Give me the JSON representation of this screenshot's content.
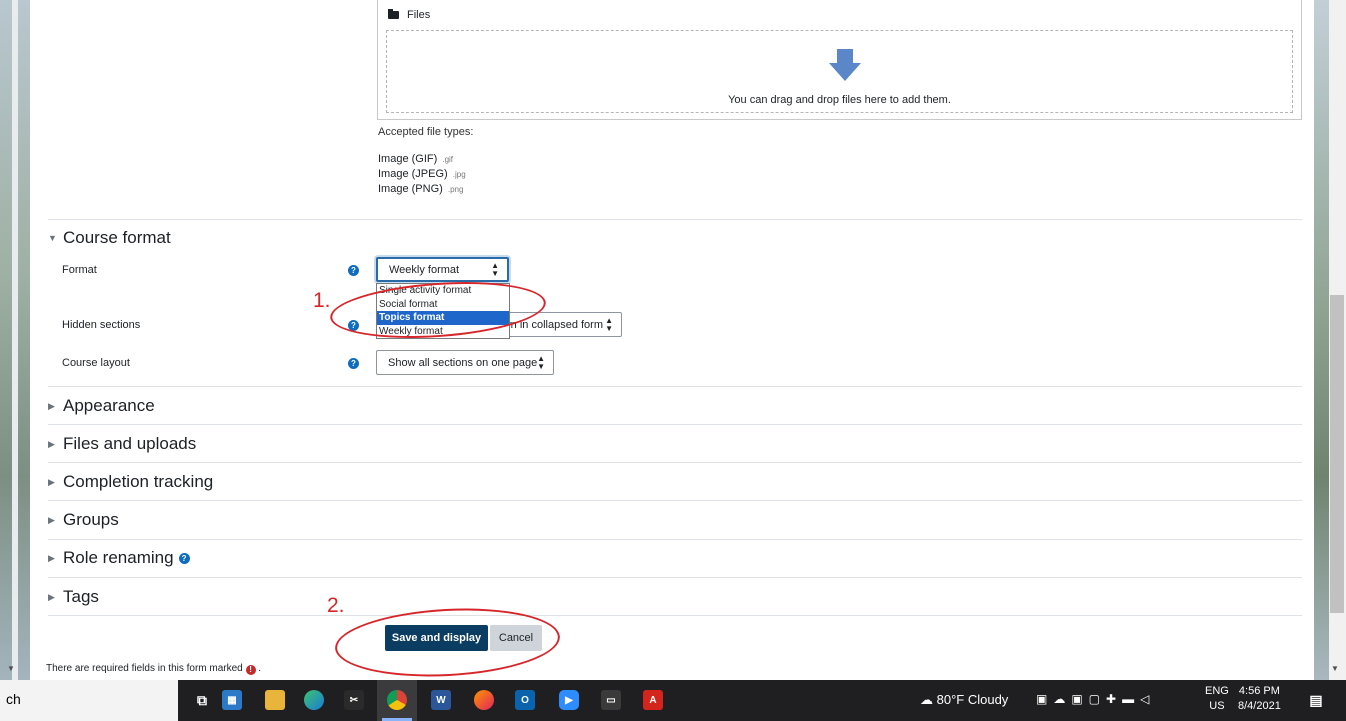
{
  "file_picker": {
    "header": "Files",
    "drop_text": "You can drag and drop files here to add them.",
    "accepted_label": "Accepted file types:",
    "types": [
      {
        "name": "Image (GIF)",
        "ext": ".gif"
      },
      {
        "name": "Image (JPEG)",
        "ext": ".jpg"
      },
      {
        "name": "Image (PNG)",
        "ext": ".png"
      }
    ]
  },
  "course_format": {
    "title": "Course format",
    "format_label": "Format",
    "format_value": "Weekly format",
    "format_options": [
      "Single activity format",
      "Social format",
      "Topics format",
      "Weekly format"
    ],
    "format_highlighted": "Topics format",
    "hidden_sections_label": "Hidden sections",
    "hidden_sections_value_visible": "wn in collapsed form",
    "course_layout_label": "Course layout",
    "course_layout_value": "Show all sections on one page"
  },
  "sections": [
    {
      "title": "Appearance"
    },
    {
      "title": "Files and uploads"
    },
    {
      "title": "Completion tracking"
    },
    {
      "title": "Groups"
    },
    {
      "title": "Role renaming"
    },
    {
      "title": "Tags"
    }
  ],
  "buttons": {
    "save": "Save and display",
    "cancel": "Cancel"
  },
  "required_note": "There are required fields in this form marked",
  "annotations": {
    "one": "1.",
    "two": "2."
  },
  "taskbar": {
    "search_fragment": "ch",
    "weather": "80°F  Cloudy",
    "lang_top": "ENG",
    "lang_bottom": "US",
    "time": "4:56 PM",
    "date": "8/4/2021"
  },
  "colors": {
    "accent": "#0f6cbf",
    "primary_button": "#0b3c61",
    "annotation": "#d7262b",
    "dropdown_highlight": "#1e66c9"
  }
}
